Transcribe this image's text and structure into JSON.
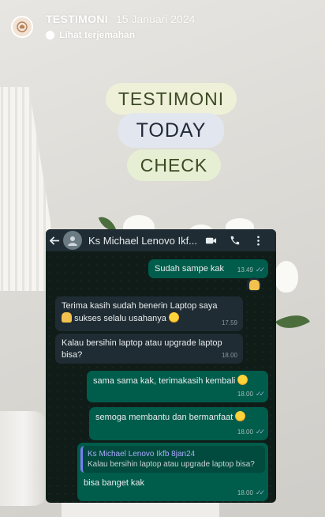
{
  "story": {
    "title": "TESTIMONI",
    "date": "15 Januari 2024",
    "translate_label": "Lihat terjemahan"
  },
  "stickers": {
    "line1": "TESTIMONI",
    "line2": "TODAY",
    "line3": "CHECK"
  },
  "chat": {
    "contact_name": "Ks Michael Lenovo Ikf...",
    "icons": [
      "back-arrow-icon",
      "profile-icon",
      "video-call-icon",
      "phone-icon",
      "more-vert-icon"
    ],
    "messages": [
      {
        "dir": "out",
        "text": "Sudah sampe kak",
        "time": "13.49",
        "reaction": "folded-hands-emoji"
      },
      {
        "dir": "in",
        "text": "Terima kasih sudah benerin Laptop saya",
        "text2": "sukses selalu usahanya",
        "time": "17.59"
      },
      {
        "dir": "in",
        "text": "Kalau bersihin laptop atau upgrade laptop bisa?",
        "time": "18.00"
      },
      {
        "dir": "out",
        "text": "sama sama kak, terimakasih kembali",
        "time": "18.00"
      },
      {
        "dir": "out",
        "text": "semoga membantu dan bermanfaat",
        "time": "18.00"
      },
      {
        "dir": "out",
        "quote_name": "Ks Michael Lenovo Ikfb 8jan24",
        "quote_text": "Kalau bersihin laptop atau upgrade laptop bisa?",
        "text": "bisa banget kak",
        "time": "18.00"
      }
    ]
  },
  "colors": {
    "out_bubble": "#005c4b",
    "in_bubble": "#1f2c33",
    "chat_bg": "#0f1c18"
  }
}
